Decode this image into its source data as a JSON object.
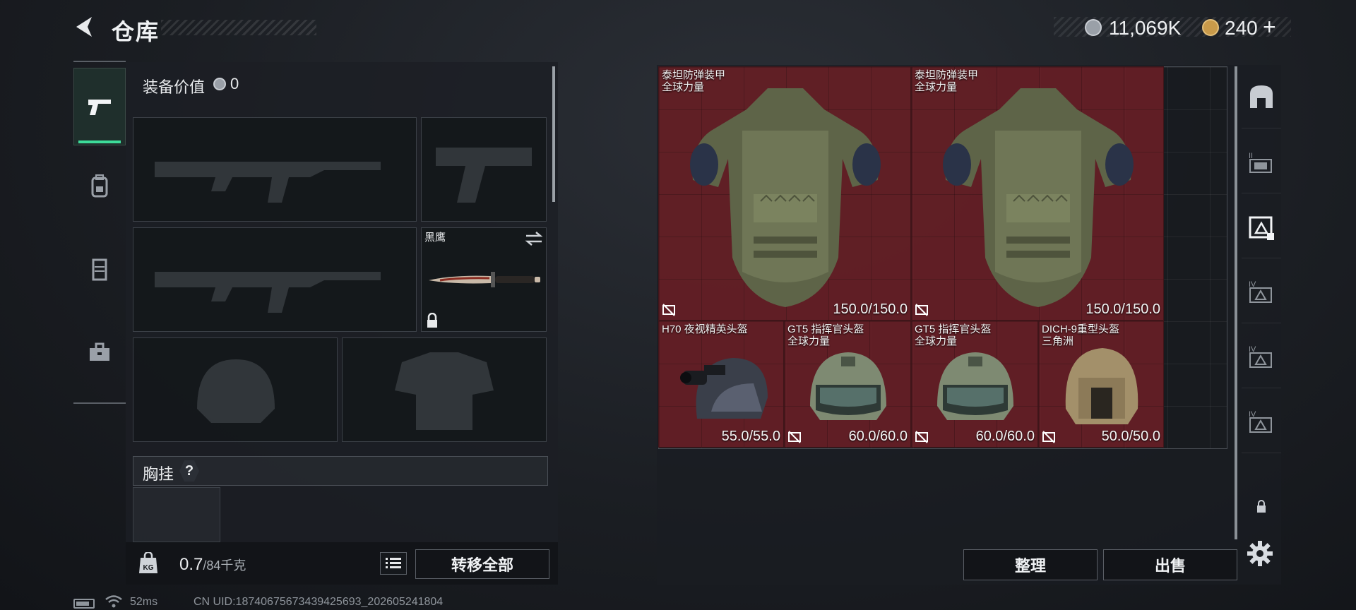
{
  "header": {
    "title": "仓库",
    "back_icon": "back-arrow-icon"
  },
  "currency": [
    {
      "icon": "coin-silver-icon",
      "value": "11,069K"
    },
    {
      "icon": "coin-gold-icon",
      "value": "240",
      "plus": "+"
    }
  ],
  "left_rail": [
    {
      "icon": "pistol-icon",
      "active": true
    },
    {
      "icon": "backpack-icon",
      "active": false
    },
    {
      "icon": "vest-icon",
      "active": false
    },
    {
      "icon": "toolbox-icon",
      "active": false
    }
  ],
  "loadout": {
    "equip_value_label": "装备价值",
    "equip_value": "0",
    "slots": [
      {
        "name": "primary-weapon-slot-1",
        "label": "",
        "empty": true
      },
      {
        "name": "sidearm-slot",
        "label": "",
        "empty": true
      },
      {
        "name": "primary-weapon-slot-2",
        "label": "",
        "empty": true
      },
      {
        "name": "melee-slot",
        "label": "黑鹰",
        "empty": false,
        "locked": true
      },
      {
        "name": "helmet-slot",
        "label": "",
        "empty": true
      },
      {
        "name": "armor-slot",
        "label": "",
        "empty": true
      }
    ],
    "chest_rig_label": "胸挂",
    "help": "?",
    "weight": "0.7",
    "weight_max": "/84千克",
    "transfer_all": "转移全部"
  },
  "storage": {
    "items": [
      {
        "name": "泰坦防弹装甲",
        "sub": "全球力量",
        "durability": "150.0/150.0",
        "type": "armor"
      },
      {
        "name": "泰坦防弹装甲",
        "sub": "全球力量",
        "durability": "150.0/150.0",
        "type": "armor"
      },
      {
        "name": "H70 夜视精英头盔",
        "sub": "",
        "durability": "55.0/55.0",
        "type": "helmet-nv"
      },
      {
        "name": "GT5 指挥官头盔",
        "sub": "全球力量",
        "durability": "60.0/60.0",
        "type": "helmet"
      },
      {
        "name": "GT5 指挥官头盔",
        "sub": "全球力量",
        "durability": "60.0/60.0",
        "type": "helmet"
      },
      {
        "name": "DICH-9重型头盔",
        "sub": "三角洲",
        "durability": "50.0/50.0",
        "type": "helmet-heavy"
      }
    ],
    "sort": "整理",
    "sell": "出售"
  },
  "right_rail": [
    {
      "icon": "safe-box-icon"
    },
    {
      "icon": "container-tier-2-icon"
    },
    {
      "icon": "container-selected-icon"
    },
    {
      "icon": "container-tier-4-icon"
    },
    {
      "icon": "container-tier-4-icon"
    },
    {
      "icon": "container-tier-4-icon"
    },
    {
      "icon": "lock-icon"
    }
  ],
  "status": {
    "ping": "52ms",
    "uid": "CN UID:18740675673439425693_202605241804"
  },
  "colors": {
    "accent": "#3ddc9a",
    "item_bg": "#6c2026"
  }
}
